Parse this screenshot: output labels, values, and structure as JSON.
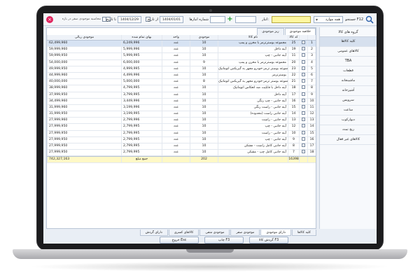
{
  "colors": {
    "accent": "#d7e3f3",
    "total_row": "#fff8c6",
    "close": "#e0245e",
    "add": "#1b9e2c",
    "highlight_input": "#fff7a0"
  },
  "toolbar": {
    "search_label": "جستجو F12",
    "group_value": "همه موارد",
    "warehouse_label": "انبار:",
    "wh_number_label": "شماره انبارها",
    "from_label": "از تاریخ",
    "from_date": "1404/01/01",
    "to_label": "تا تاریخ",
    "to_date": "1404/12/29",
    "zero_stock_label": "محاسبه موجودی صفر در بازه",
    "icons": {
      "close": "close-icon",
      "search": "search-icon",
      "add": "plus-icon"
    }
  },
  "sidebar": {
    "header": "گروه های کالا",
    "items": [
      {
        "label": "کلیه کالاها"
      },
      {
        "label": "کالاهای عمومی"
      },
      {
        "label": "TBA"
      },
      {
        "label": "قطعات"
      },
      {
        "label": "ماشینخانه"
      },
      {
        "label": "آشپزخانه"
      },
      {
        "label": "سرویس"
      },
      {
        "label": "ساعت"
      },
      {
        "label": "دیوارکوب"
      },
      {
        "label": "ریخ تمدد"
      },
      {
        "label": "کالاهای غیر فعال"
      }
    ]
  },
  "subtabs": [
    "خلاصه موجودی",
    "ریز موجودی"
  ],
  "table": {
    "headers": {
      "rowno": "",
      "check": "",
      "code": "کد کالا",
      "name": "نام کالا",
      "stock": "موجودی",
      "unit": "واحد",
      "cost": "بهای تمام شده",
      "value": "موجودی ریالی"
    },
    "rows": [
      {
        "rowno": "1",
        "code": "25",
        "name": "مجموعه بوسترترمز با مخزن و پمپ",
        "stock": "10",
        "unit": "عدد",
        "cost": "6,249,996",
        "value": "62,499,960"
      },
      {
        "rowno": "2",
        "code": "19",
        "name": "آینه داخل",
        "stock": "10",
        "unit": "عدد",
        "cost": "5,999,996",
        "value": "59,999,960"
      },
      {
        "rowno": "3",
        "code": "11",
        "name": "آینه جانبی - چپ",
        "stock": "10",
        "unit": "عدد",
        "cost": "5,999,995",
        "value": "59,999,950"
      },
      {
        "rowno": "4",
        "code": "20",
        "name": "مجموعه بوسترترمز با مخزن و پمپ",
        "stock": "9",
        "unit": "عدد",
        "cost": "6,000,000",
        "value": "54,000,000"
      },
      {
        "rowno": "5",
        "code": "23",
        "name": "مجموعه بوستر ترمز-خودرو مجهز به گیربکس اتوماتیک",
        "stock": "10",
        "unit": "عدد",
        "cost": "4,999,995",
        "value": "49,999,950"
      },
      {
        "rowno": "6",
        "code": "22",
        "name": "بوسترترمز",
        "stock": "10",
        "unit": "عدد",
        "cost": "4,499,996",
        "value": "44,999,960"
      },
      {
        "rowno": "7",
        "code": "21",
        "name": "مجموعه بوستر ترمز-خودرو مجهز به گیربکس اتوماتیک",
        "stock": "8",
        "unit": "عدد",
        "cost": "5,000,000",
        "value": "40,000,000"
      },
      {
        "rowno": "8",
        "code": "18",
        "name": "آینه داخل با قابلیت ضد انعکاس اتوماتیک",
        "stock": "10",
        "unit": "عدد",
        "cost": "4,799,995",
        "value": "38,999,960"
      },
      {
        "rowno": "9",
        "code": "17",
        "name": "آینه داخل",
        "stock": "10",
        "unit": "عدد",
        "cost": "3,799,995",
        "value": "37,999,950"
      },
      {
        "rowno": "10",
        "code": "16",
        "name": "آینه جانبی - چپ رنگی",
        "stock": "10",
        "unit": "عدد",
        "cost": "3,449,996",
        "value": "34,499,960"
      },
      {
        "rowno": "11",
        "code": "15",
        "name": "آینه جانبی - راست رنگی",
        "stock": "10",
        "unit": "عدد",
        "cost": "3,199,996",
        "value": "31,999,960"
      },
      {
        "rowno": "12",
        "code": "14",
        "name": "آینه جانبی راست (محدوده)",
        "stock": "10",
        "unit": "عدد",
        "cost": "3,199,995",
        "value": "31,999,950"
      },
      {
        "rowno": "13",
        "code": "13",
        "name": "آینه جانبی - راست",
        "stock": "10",
        "unit": "عدد",
        "cost": "2,799,996",
        "value": "27,999,960"
      },
      {
        "rowno": "14",
        "code": "12",
        "name": "آینه جانبی - چپ",
        "stock": "10",
        "unit": "عدد",
        "cost": "2,799,995",
        "value": "27,999,950"
      },
      {
        "rowno": "15",
        "code": "10",
        "name": "آینه جانبی - راست",
        "stock": "10",
        "unit": "عدد",
        "cost": "2,799,995",
        "value": "27,999,950"
      },
      {
        "rowno": "16",
        "code": "9",
        "name": "آینه جانبی - چپ",
        "stock": "10",
        "unit": "عدد",
        "cost": "2,799,995",
        "value": "27,999,950"
      },
      {
        "rowno": "17",
        "code": "8",
        "name": "آینه جانبی کامل راست - مشکی",
        "stock": "10",
        "unit": "عدد",
        "cost": "2,799,995",
        "value": "27,999,950"
      },
      {
        "rowno": "18",
        "code": "7",
        "name": "آینه جانبی کامل چپ - مشکی",
        "stock": "10",
        "unit": "عدد",
        "cost": "2,799,995",
        "value": "27,999,950"
      }
    ],
    "footer": {
      "code": "16398",
      "stock": "202",
      "cost_label": "جمع مبلغ",
      "value": "742,327,163"
    }
  },
  "bottom_tabs": [
    "کلیه کالاها",
    "دارای موجودی",
    "موجودی صفر",
    "موجودی منفی",
    "کالاهای کسری",
    "دارای گردش"
  ],
  "buttons": {
    "turnover": "گردش کالا F3",
    "print": "چاپ F3",
    "exit": "خروج Esc"
  }
}
